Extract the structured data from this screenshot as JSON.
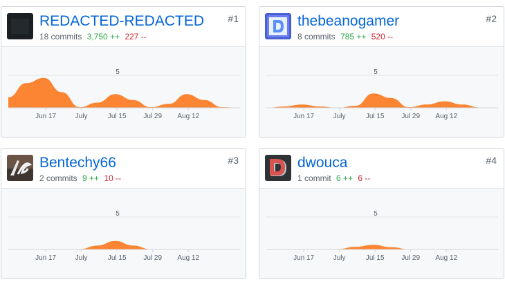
{
  "contributors": [
    {
      "rank": "#1",
      "username": "REDACTED-REDACTED",
      "commits": "18 commits",
      "additions": "3,750 ++",
      "deletions": "227 --",
      "avatar": "dark-avatar",
      "chart_data": {
        "type": "area",
        "x_ticks": [
          "Jun 17",
          "July",
          "Jul 15",
          "Jul 29",
          "Aug 12"
        ],
        "y_ticks": [
          5
        ],
        "ylim": [
          0,
          8.5
        ],
        "grid": true,
        "color": "#fb8532",
        "points": [
          [
            0,
            1.6
          ],
          [
            0.5,
            3.8
          ],
          [
            1,
            4.6
          ],
          [
            1.5,
            2.4
          ],
          [
            2,
            0.1
          ],
          [
            2.5,
            0.8
          ],
          [
            3,
            2.1
          ],
          [
            3.5,
            1.2
          ],
          [
            4,
            0.1
          ],
          [
            4.5,
            0.6
          ],
          [
            5,
            2.1
          ],
          [
            5.5,
            1.2
          ],
          [
            6,
            0.1
          ],
          [
            6.5,
            0
          ]
        ]
      }
    },
    {
      "rank": "#2",
      "username": "thebeanogamer",
      "commits": "8 commits",
      "additions": "785 ++",
      "deletions": "520 --",
      "avatar": "blue-d-avatar",
      "chart_data": {
        "type": "area",
        "x_ticks": [
          "Jun 17",
          "July",
          "Jul 15",
          "Jul 29",
          "Aug 12"
        ],
        "y_ticks": [
          5
        ],
        "ylim": [
          0,
          8.5
        ],
        "grid": true,
        "color": "#fb8532",
        "points": [
          [
            0,
            0
          ],
          [
            0.5,
            0.2
          ],
          [
            1,
            0.5
          ],
          [
            1.5,
            0.2
          ],
          [
            2,
            0
          ],
          [
            2.5,
            0.3
          ],
          [
            3,
            2.2
          ],
          [
            3.5,
            1.5
          ],
          [
            4,
            0.1
          ],
          [
            4.5,
            0.5
          ],
          [
            5,
            1.0
          ],
          [
            5.5,
            0.5
          ],
          [
            6,
            0.05
          ],
          [
            6.5,
            0
          ]
        ]
      }
    },
    {
      "rank": "#3",
      "username": "Bentechy66",
      "commits": "2 commits",
      "additions": "9 ++",
      "deletions": "10 --",
      "avatar": "bg-initials-avatar",
      "chart_data": {
        "type": "area",
        "x_ticks": [
          "Jun 17",
          "July",
          "Jul 15",
          "Jul 29",
          "Aug 12"
        ],
        "y_ticks": [
          5
        ],
        "ylim": [
          0,
          8.5
        ],
        "grid": true,
        "color": "#fb8532",
        "points": [
          [
            0,
            0
          ],
          [
            1,
            0
          ],
          [
            2,
            0.05
          ],
          [
            2.5,
            0.6
          ],
          [
            3,
            1.3
          ],
          [
            3.5,
            0.6
          ],
          [
            4,
            0.05
          ],
          [
            5,
            0
          ],
          [
            6.5,
            0
          ]
        ]
      }
    },
    {
      "rank": "#4",
      "username": "dwouca",
      "commits": "1 commit",
      "additions": "6 ++",
      "deletions": "6 --",
      "avatar": "red-d-avatar",
      "chart_data": {
        "type": "area",
        "x_ticks": [
          "Jun 17",
          "July",
          "Jul 15",
          "Jul 29",
          "Aug 12"
        ],
        "y_ticks": [
          5
        ],
        "ylim": [
          0,
          8.5
        ],
        "grid": true,
        "color": "#fb8532",
        "points": [
          [
            0,
            0
          ],
          [
            1,
            0
          ],
          [
            2,
            0.05
          ],
          [
            2.5,
            0.4
          ],
          [
            3,
            0.7
          ],
          [
            3.5,
            0.35
          ],
          [
            4,
            0.05
          ],
          [
            5,
            0
          ],
          [
            6.5,
            0
          ]
        ]
      }
    }
  ]
}
